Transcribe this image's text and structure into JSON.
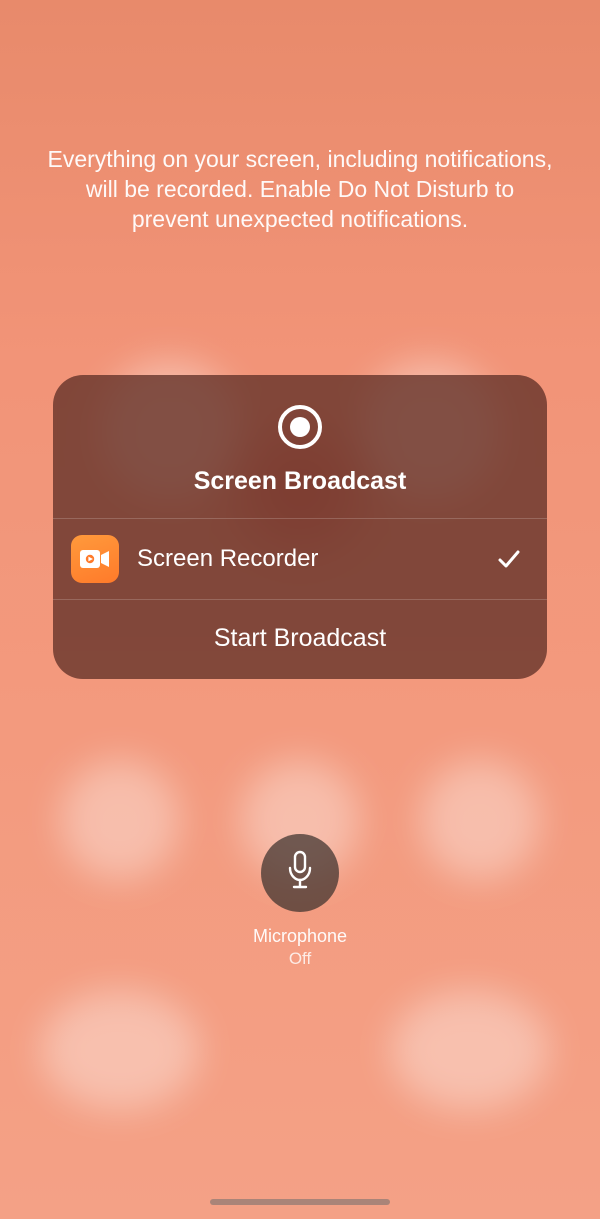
{
  "notice": "Everything on your screen, including notifications, will be recorded. Enable Do Not Disturb to prevent unexpected notifications.",
  "card": {
    "title": "Screen Broadcast",
    "app_label": "Screen Recorder",
    "start_label": "Start Broadcast"
  },
  "microphone": {
    "label": "Microphone",
    "state": "Off"
  },
  "icons": {
    "record": "record-icon",
    "camera": "camera-icon",
    "checkmark": "checkmark-icon",
    "mic": "microphone-icon"
  }
}
